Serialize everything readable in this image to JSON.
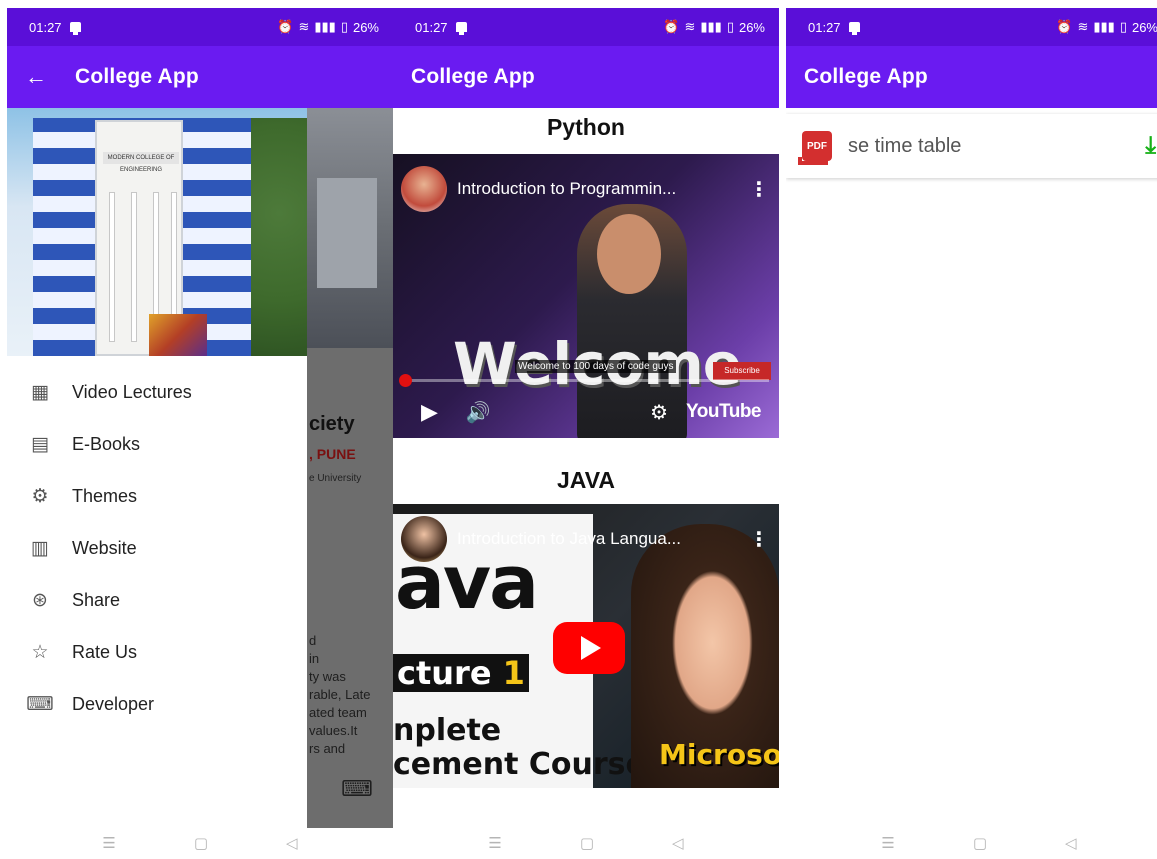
{
  "status": {
    "time": "01:27",
    "battery": "26%",
    "icons": [
      "alarm-icon",
      "wifi-icon",
      "signal-icon",
      "battery-icon"
    ]
  },
  "app_title": "College App",
  "colors": {
    "appbar": "#6a1bf1",
    "statusbar": "#5a0fd8",
    "download": "#16b016",
    "pdf": "#d32f2f"
  },
  "screen1": {
    "menu": [
      {
        "label": "Video Lectures",
        "icon": "video-lecture-icon"
      },
      {
        "label": "E-Books",
        "icon": "ebook-icon"
      },
      {
        "label": "Themes",
        "icon": "themes-icon"
      },
      {
        "label": "Website",
        "icon": "website-icon"
      },
      {
        "label": "Share",
        "icon": "share-icon"
      },
      {
        "label": "Rate Us",
        "icon": "rate-us-icon"
      },
      {
        "label": "Developer",
        "icon": "developer-icon"
      }
    ],
    "banner_sign": "MODERN COLLEGE OF ENGINEERING",
    "behind": {
      "heading": "ciety",
      "city": ", PUNE",
      "university": "e University",
      "para": [
        "d",
        "in",
        "ty was",
        "rable, Late",
        "ated team",
        "values.It",
        "rs and"
      ]
    }
  },
  "screen2": {
    "sections": [
      {
        "title": "Python",
        "video_title": "Introduction to Programmin...",
        "big_text": "Welcome",
        "caption": "Welcome to 100 days of code guys",
        "subscribe": "Subscribe",
        "brand": "YouTube"
      },
      {
        "title": "JAVA",
        "video_title": "Introduction to Java Langua...",
        "thumb_big": "ava",
        "thumb_lecture": "cture",
        "thumb_number": "1",
        "thumb_line1": "nplete",
        "thumb_line2": "cement Course",
        "thumb_brand": "Microsof"
      }
    ]
  },
  "screen3": {
    "file": {
      "name": "se time table",
      "badge": "PDF"
    }
  },
  "nav": {
    "menu": "☰",
    "home": "▢",
    "back": "◁"
  }
}
